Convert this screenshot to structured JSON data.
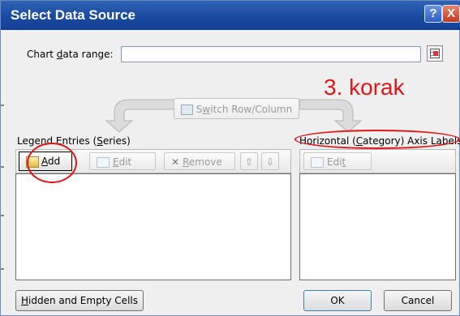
{
  "window": {
    "title": "Select Data Source",
    "help_glyph": "?",
    "close_glyph": "X"
  },
  "chart_range": {
    "label_pre": "Chart ",
    "label_key": "d",
    "label_post": "ata range:",
    "value": ""
  },
  "switch_button": {
    "label_pre": "S",
    "label_key": "w",
    "label_post": "itch Row/Column"
  },
  "legend": {
    "label_pre": "Legend Entries (",
    "label_key": "S",
    "label_post": "eries)",
    "add": {
      "key": "A",
      "rest": "dd"
    },
    "edit": {
      "key": "E",
      "rest": "dit"
    },
    "remove": {
      "glyph": "✕",
      "key": "R",
      "rest": "emove"
    },
    "up_glyph": "⇧",
    "down_glyph": "⇩",
    "items": []
  },
  "axis": {
    "label_pre": "Horizontal (",
    "label_key": "C",
    "label_post": "ategory) Axis Labels",
    "edit": {
      "pre": "Edi",
      "key": "t"
    },
    "items": []
  },
  "footer": {
    "hidden_key": "H",
    "hidden_rest": "idden and Empty Cells",
    "ok": "OK",
    "cancel": "Cancel"
  },
  "annotation": {
    "text": "3. korak",
    "color": "#e01717"
  },
  "colors": {
    "title_bar": "#1a4aa0",
    "dialog_bg": "#f0f0f0",
    "annotation": "#e01717"
  }
}
